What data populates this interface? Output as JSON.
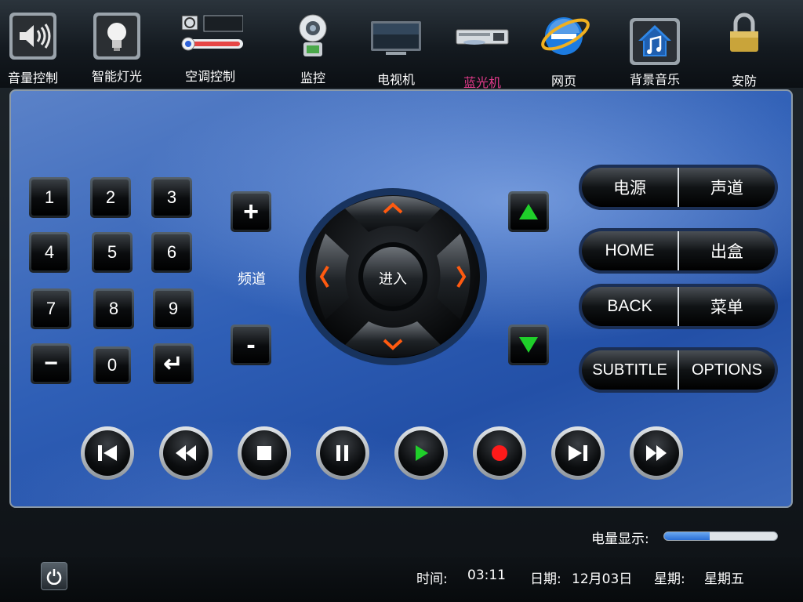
{
  "nav": [
    {
      "label": "音量控制",
      "icon": "speaker-icon"
    },
    {
      "label": "智能灯光",
      "icon": "lightbulb-icon"
    },
    {
      "label": "空调控制",
      "icon": "air-conditioner-icon"
    },
    {
      "label": "监控",
      "icon": "webcam-icon"
    },
    {
      "label": "电视机",
      "icon": "tv-icon"
    },
    {
      "label": "蓝光机",
      "icon": "bluray-player-icon",
      "active": true
    },
    {
      "label": "网页",
      "icon": "internet-explorer-icon"
    },
    {
      "label": "背景音乐",
      "icon": "music-house-icon"
    },
    {
      "label": "安防",
      "icon": "padlock-icon"
    }
  ],
  "numpad": [
    "1",
    "2",
    "3",
    "4",
    "5",
    "6",
    "7",
    "8",
    "9",
    "−",
    "0",
    "↵"
  ],
  "channel": {
    "label": "频道",
    "plus": "+",
    "minus": "-"
  },
  "dpad": {
    "center_label": "进入"
  },
  "volume_arrows": {
    "up": "▲",
    "down": "▼"
  },
  "function_pills": [
    {
      "left": "电源",
      "right": "声道"
    },
    {
      "left": "HOME",
      "right": "出盒"
    },
    {
      "left": "BACK",
      "right": "菜单"
    },
    {
      "left": "SUBTITLE",
      "right": "OPTIONS"
    }
  ],
  "transport": [
    "skip-previous-icon",
    "rewind-icon",
    "stop-icon",
    "pause-icon",
    "play-icon",
    "record-icon",
    "skip-next-icon",
    "fast-forward-icon"
  ],
  "battery": {
    "label": "电量显示:",
    "level": 0.4
  },
  "status": {
    "time_label": "时间:",
    "time_value": "03:11",
    "date_label": "日期:",
    "date_value": "12月03日",
    "weekday_label": "星期:",
    "weekday_value": "星期五"
  },
  "colors": {
    "accent_active": "#e23a8a",
    "arrow_green": "#1fcf2a",
    "arrow_orange": "#ff5a10",
    "record_red": "#ff1a1a"
  }
}
